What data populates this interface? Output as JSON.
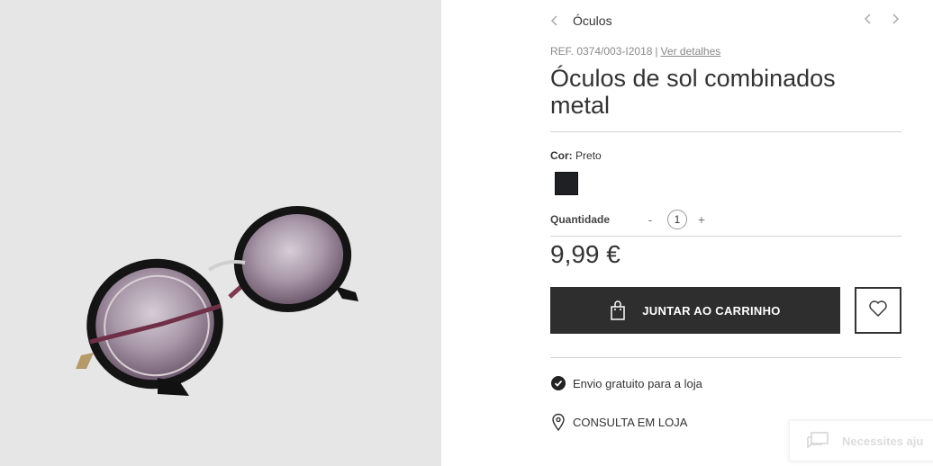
{
  "breadcrumb": {
    "label": "Óculos"
  },
  "product": {
    "ref_label": "REF. 0374/003-I2018",
    "ref_separator": "|",
    "details_link": "Ver detalhes",
    "title": "Óculos de sol combinados metal",
    "color_label": "Cor:",
    "color_value": "Preto",
    "swatch_color": "#1e2024",
    "quantity_label": "Quantidade",
    "quantity_minus": "-",
    "quantity_value": "1",
    "quantity_plus": "+",
    "price": "9,99 €"
  },
  "actions": {
    "add_to_cart": "JUNTAR AO CARRINHO",
    "cart_button_color": "#2e2e2e"
  },
  "info": {
    "free_shipping": "Envio gratuito para a loja",
    "store_check": "CONSULTA EM LOJA"
  },
  "help_widget": {
    "label": "Necessites aju"
  },
  "icons": [
    "chevron-left-icon",
    "chevron-right-icon",
    "shopping-bag-icon",
    "heart-icon",
    "check-circle-icon",
    "map-pin-icon",
    "chat-icon"
  ]
}
